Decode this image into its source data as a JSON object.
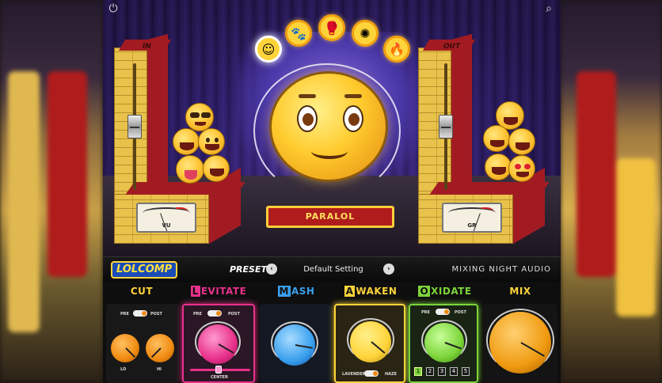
{
  "window": {
    "power_icon": "power-icon",
    "search_icon": "search-icon"
  },
  "stage": {
    "input_label": "IN",
    "output_label": "OUT",
    "input_meter_label": "VU",
    "output_meter_label": "GR",
    "mode_name": "PARALOL",
    "modes": [
      {
        "icon": "smiley-icon",
        "glyph": "☺",
        "active": true
      },
      {
        "icon": "paw-icon",
        "glyph": "🐾",
        "active": false
      },
      {
        "icon": "boxing-glove-icon",
        "glyph": "🥊",
        "active": false
      },
      {
        "icon": "peacock-icon",
        "glyph": "✺",
        "active": false
      },
      {
        "icon": "fire-icon",
        "glyph": "🔥",
        "active": false
      }
    ]
  },
  "preset_bar": {
    "logo": "LOLCOMP",
    "preset_label": "PRESET:",
    "prev_glyph": "‹",
    "next_glyph": "›",
    "preset_value": "Default Setting",
    "brand": "MIXING NIGHT AUDIO"
  },
  "modules": {
    "cut": {
      "title": "CUT",
      "pre": "PRE",
      "post": "POST",
      "lo": "LO",
      "hi": "HI"
    },
    "levitate": {
      "cap": "L",
      "rest": "EVITATE",
      "pre": "PRE",
      "post": "POST",
      "center": "CENTER"
    },
    "mash": {
      "cap": "M",
      "rest": "ASH"
    },
    "awaken": {
      "cap": "A",
      "rest": "WAKEN",
      "lavender": "LAVENDER",
      "haze": "HAZE"
    },
    "oxidate": {
      "cap": "O",
      "rest": "XIDATE",
      "pre": "PRE",
      "post": "POST",
      "buttons": [
        "1",
        "2",
        "3",
        "4",
        "5"
      ],
      "selected": "1"
    },
    "mix": {
      "title": "MIX"
    }
  },
  "colors": {
    "accent": "#ffd43a",
    "red": "#a31b22",
    "brick": "#e8c24a",
    "pink": "#e8308a",
    "blue": "#3aa0ee",
    "lime": "#7cd43a",
    "orange": "#f09a10"
  }
}
